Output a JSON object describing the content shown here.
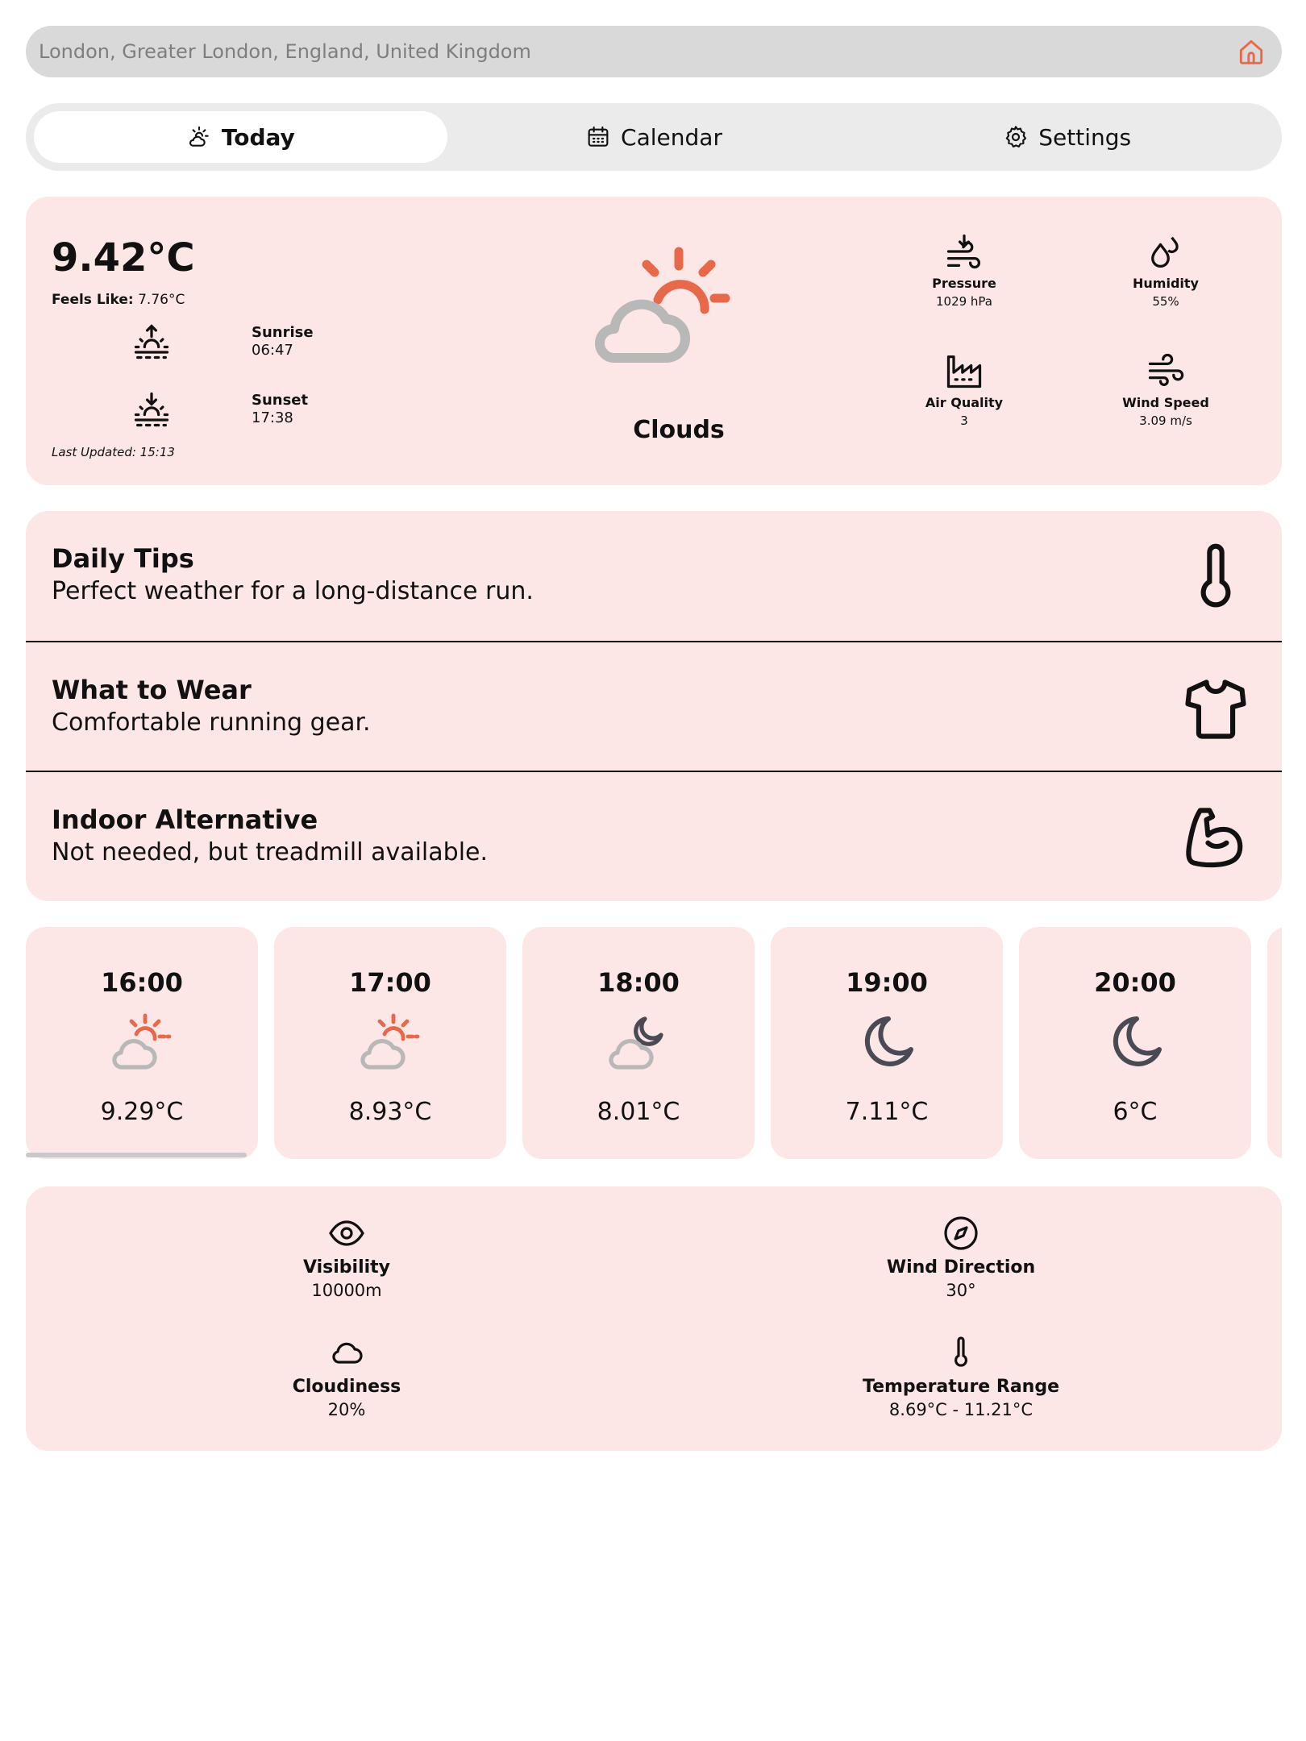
{
  "search": {
    "placeholder": "London, Greater London, England, United Kingdom"
  },
  "tabs": [
    {
      "label": "Today",
      "icon": "sun-cloud-icon",
      "active": true
    },
    {
      "label": "Calendar",
      "icon": "calendar-icon",
      "active": false
    },
    {
      "label": "Settings",
      "icon": "gear-icon",
      "active": false
    }
  ],
  "current": {
    "temperature": "9.42°C",
    "feels_like_label": "Feels Like:",
    "feels_like_value": "7.76°C",
    "sunrise_label": "Sunrise",
    "sunrise_time": "06:47",
    "sunset_label": "Sunset",
    "sunset_time": "17:38",
    "last_updated": "Last Updated: 15:13",
    "condition": "Clouds",
    "stats": {
      "pressure": {
        "label": "Pressure",
        "value": "1029 hPa"
      },
      "humidity": {
        "label": "Humidity",
        "value": "55%"
      },
      "air_quality": {
        "label": "Air Quality",
        "value": "3"
      },
      "wind_speed": {
        "label": "Wind Speed",
        "value": "3.09 m/s"
      }
    }
  },
  "tips": [
    {
      "title": "Daily Tips",
      "text": "Perfect weather for a long-distance run.",
      "icon": "thermometer-icon"
    },
    {
      "title": "What to Wear",
      "text": "Comfortable running gear.",
      "icon": "shirt-icon"
    },
    {
      "title": "Indoor Alternative",
      "text": "Not needed, but treadmill available.",
      "icon": "muscle-icon"
    }
  ],
  "hourly": [
    {
      "time": "16:00",
      "temp": "9.29°C",
      "icon": "sun-cloud-icon"
    },
    {
      "time": "17:00",
      "temp": "8.93°C",
      "icon": "sun-cloud-icon"
    },
    {
      "time": "18:00",
      "temp": "8.01°C",
      "icon": "moon-cloud-icon"
    },
    {
      "time": "19:00",
      "temp": "7.11°C",
      "icon": "moon-icon"
    },
    {
      "time": "20:00",
      "temp": "6°C",
      "icon": "moon-icon"
    }
  ],
  "details": {
    "visibility": {
      "label": "Visibility",
      "value": "10000m"
    },
    "wind_direction": {
      "label": "Wind Direction",
      "value": "30°"
    },
    "cloudiness": {
      "label": "Cloudiness",
      "value": "20%"
    },
    "temperature_range": {
      "label": "Temperature Range",
      "value": "8.69°C - 11.21°C"
    }
  },
  "colors": {
    "accent": "#e8684a",
    "card_background": "#fde6e6",
    "cloud_gray": "#b8b8b8",
    "moon": "#4a4a55"
  }
}
